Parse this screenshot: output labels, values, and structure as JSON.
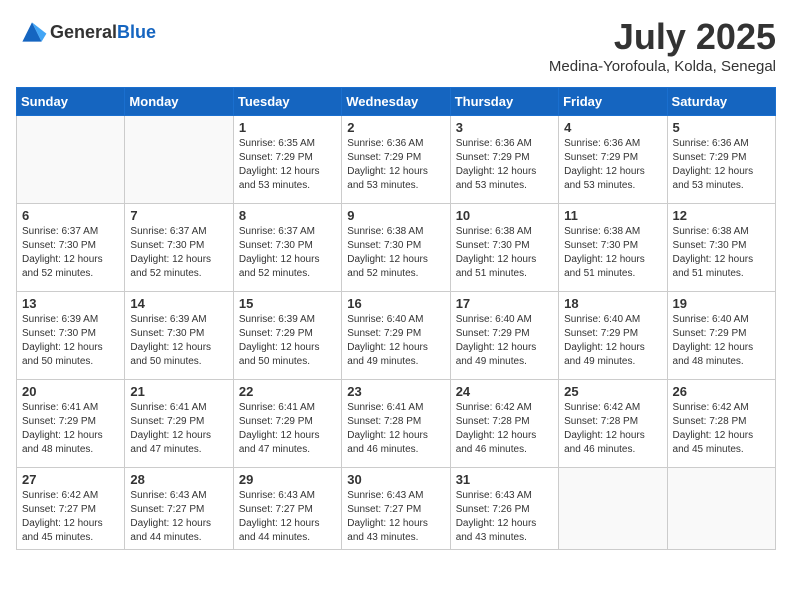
{
  "header": {
    "logo": {
      "text_general": "General",
      "text_blue": "Blue"
    },
    "month_year": "July 2025",
    "location": "Medina-Yorofoula, Kolda, Senegal"
  },
  "weekdays": [
    "Sunday",
    "Monday",
    "Tuesday",
    "Wednesday",
    "Thursday",
    "Friday",
    "Saturday"
  ],
  "weeks": [
    [
      {
        "day": "",
        "info": ""
      },
      {
        "day": "",
        "info": ""
      },
      {
        "day": "1",
        "info": "Sunrise: 6:35 AM\nSunset: 7:29 PM\nDaylight: 12 hours\nand 53 minutes."
      },
      {
        "day": "2",
        "info": "Sunrise: 6:36 AM\nSunset: 7:29 PM\nDaylight: 12 hours\nand 53 minutes."
      },
      {
        "day": "3",
        "info": "Sunrise: 6:36 AM\nSunset: 7:29 PM\nDaylight: 12 hours\nand 53 minutes."
      },
      {
        "day": "4",
        "info": "Sunrise: 6:36 AM\nSunset: 7:29 PM\nDaylight: 12 hours\nand 53 minutes."
      },
      {
        "day": "5",
        "info": "Sunrise: 6:36 AM\nSunset: 7:29 PM\nDaylight: 12 hours\nand 53 minutes."
      }
    ],
    [
      {
        "day": "6",
        "info": "Sunrise: 6:37 AM\nSunset: 7:30 PM\nDaylight: 12 hours\nand 52 minutes."
      },
      {
        "day": "7",
        "info": "Sunrise: 6:37 AM\nSunset: 7:30 PM\nDaylight: 12 hours\nand 52 minutes."
      },
      {
        "day": "8",
        "info": "Sunrise: 6:37 AM\nSunset: 7:30 PM\nDaylight: 12 hours\nand 52 minutes."
      },
      {
        "day": "9",
        "info": "Sunrise: 6:38 AM\nSunset: 7:30 PM\nDaylight: 12 hours\nand 52 minutes."
      },
      {
        "day": "10",
        "info": "Sunrise: 6:38 AM\nSunset: 7:30 PM\nDaylight: 12 hours\nand 51 minutes."
      },
      {
        "day": "11",
        "info": "Sunrise: 6:38 AM\nSunset: 7:30 PM\nDaylight: 12 hours\nand 51 minutes."
      },
      {
        "day": "12",
        "info": "Sunrise: 6:38 AM\nSunset: 7:30 PM\nDaylight: 12 hours\nand 51 minutes."
      }
    ],
    [
      {
        "day": "13",
        "info": "Sunrise: 6:39 AM\nSunset: 7:30 PM\nDaylight: 12 hours\nand 50 minutes."
      },
      {
        "day": "14",
        "info": "Sunrise: 6:39 AM\nSunset: 7:30 PM\nDaylight: 12 hours\nand 50 minutes."
      },
      {
        "day": "15",
        "info": "Sunrise: 6:39 AM\nSunset: 7:29 PM\nDaylight: 12 hours\nand 50 minutes."
      },
      {
        "day": "16",
        "info": "Sunrise: 6:40 AM\nSunset: 7:29 PM\nDaylight: 12 hours\nand 49 minutes."
      },
      {
        "day": "17",
        "info": "Sunrise: 6:40 AM\nSunset: 7:29 PM\nDaylight: 12 hours\nand 49 minutes."
      },
      {
        "day": "18",
        "info": "Sunrise: 6:40 AM\nSunset: 7:29 PM\nDaylight: 12 hours\nand 49 minutes."
      },
      {
        "day": "19",
        "info": "Sunrise: 6:40 AM\nSunset: 7:29 PM\nDaylight: 12 hours\nand 48 minutes."
      }
    ],
    [
      {
        "day": "20",
        "info": "Sunrise: 6:41 AM\nSunset: 7:29 PM\nDaylight: 12 hours\nand 48 minutes."
      },
      {
        "day": "21",
        "info": "Sunrise: 6:41 AM\nSunset: 7:29 PM\nDaylight: 12 hours\nand 47 minutes."
      },
      {
        "day": "22",
        "info": "Sunrise: 6:41 AM\nSunset: 7:29 PM\nDaylight: 12 hours\nand 47 minutes."
      },
      {
        "day": "23",
        "info": "Sunrise: 6:41 AM\nSunset: 7:28 PM\nDaylight: 12 hours\nand 46 minutes."
      },
      {
        "day": "24",
        "info": "Sunrise: 6:42 AM\nSunset: 7:28 PM\nDaylight: 12 hours\nand 46 minutes."
      },
      {
        "day": "25",
        "info": "Sunrise: 6:42 AM\nSunset: 7:28 PM\nDaylight: 12 hours\nand 46 minutes."
      },
      {
        "day": "26",
        "info": "Sunrise: 6:42 AM\nSunset: 7:28 PM\nDaylight: 12 hours\nand 45 minutes."
      }
    ],
    [
      {
        "day": "27",
        "info": "Sunrise: 6:42 AM\nSunset: 7:27 PM\nDaylight: 12 hours\nand 45 minutes."
      },
      {
        "day": "28",
        "info": "Sunrise: 6:43 AM\nSunset: 7:27 PM\nDaylight: 12 hours\nand 44 minutes."
      },
      {
        "day": "29",
        "info": "Sunrise: 6:43 AM\nSunset: 7:27 PM\nDaylight: 12 hours\nand 44 minutes."
      },
      {
        "day": "30",
        "info": "Sunrise: 6:43 AM\nSunset: 7:27 PM\nDaylight: 12 hours\nand 43 minutes."
      },
      {
        "day": "31",
        "info": "Sunrise: 6:43 AM\nSunset: 7:26 PM\nDaylight: 12 hours\nand 43 minutes."
      },
      {
        "day": "",
        "info": ""
      },
      {
        "day": "",
        "info": ""
      }
    ]
  ]
}
